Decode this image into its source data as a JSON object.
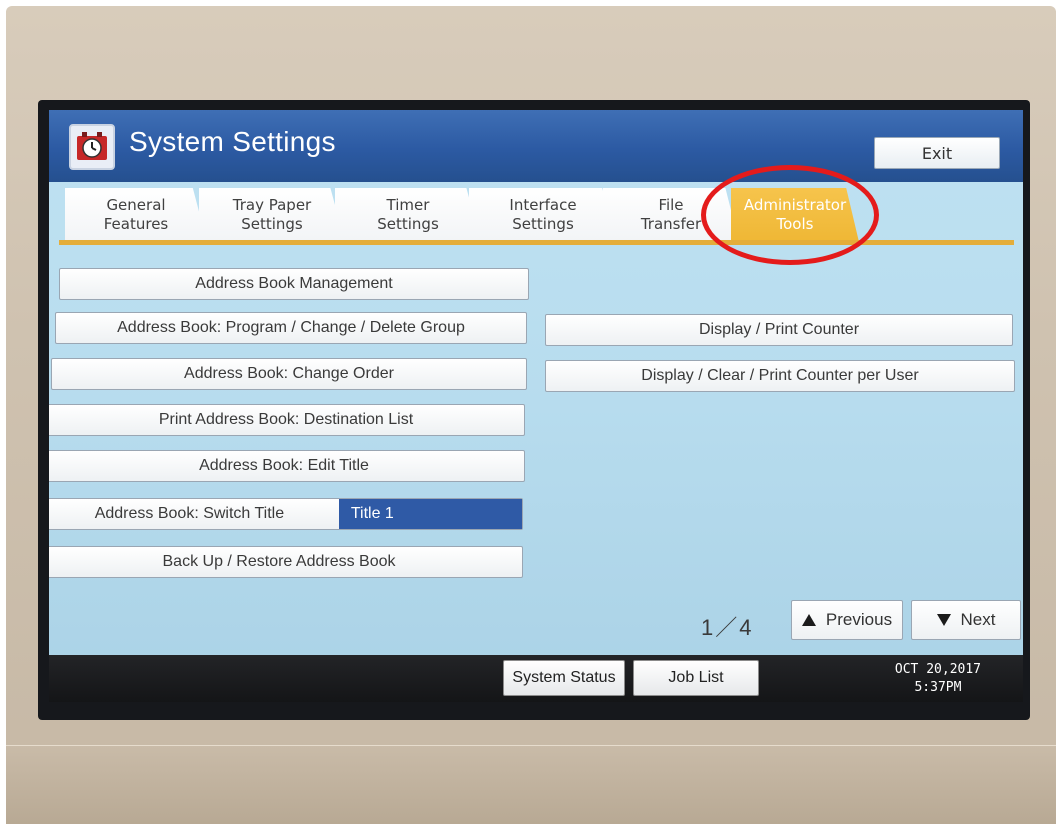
{
  "header": {
    "title": "System Settings",
    "exit_label": "Exit"
  },
  "tabs": [
    {
      "line1": "General",
      "line2": "Features",
      "active": false
    },
    {
      "line1": "Tray Paper",
      "line2": "Settings",
      "active": false
    },
    {
      "line1": "Timer",
      "line2": "Settings",
      "active": false
    },
    {
      "line1": "Interface",
      "line2": "Settings",
      "active": false
    },
    {
      "line1": "File",
      "line2": "Transfer",
      "active": false
    },
    {
      "line1": "Administrator",
      "line2": "Tools",
      "active": true
    }
  ],
  "left_buttons": [
    {
      "label": "Address Book Management"
    },
    {
      "label": "Address Book: Program / Change / Delete Group"
    },
    {
      "label": "Address Book: Change Order"
    },
    {
      "label": "Print Address Book: Destination List"
    },
    {
      "label": "Address Book: Edit Title"
    },
    {
      "label": "Address Book: Switch Title",
      "value": "Title 1"
    },
    {
      "label": "Back Up / Restore Address Book"
    }
  ],
  "right_buttons": [
    {
      "label": "Display / Print Counter"
    },
    {
      "label": "Display / Clear / Print Counter per User"
    }
  ],
  "pagination": {
    "indicator": "1／4",
    "previous_label": "Previous",
    "next_label": "Next"
  },
  "statusbar": {
    "system_status_label": "System Status",
    "job_list_label": "Job List",
    "date": "OCT  20,2017",
    "time": "5:37PM"
  },
  "colors": {
    "titlebar": "#2c5aa3",
    "active_tab": "#f0b93a",
    "screen_bg": "#b9ddef",
    "selected_value": "#2f5aa6",
    "annotation_ring": "#e41b1b"
  }
}
